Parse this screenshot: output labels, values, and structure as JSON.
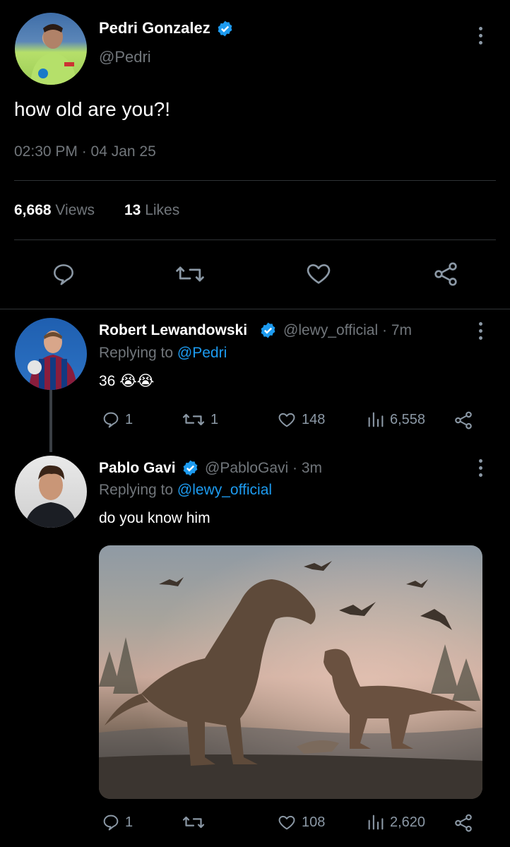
{
  "main_tweet": {
    "author_name": "Pedri Gonzalez",
    "handle": "@Pedri",
    "text": "how old are you?!",
    "timestamp": "02:30 PM · 04 Jan 25",
    "views_count": "6,668",
    "views_label": "Views",
    "likes_count": "13",
    "likes_label": "Likes"
  },
  "reply1": {
    "author_name": "Robert Lewandowski",
    "handle_time": "@lewy_official · 7m",
    "replying_prefix": "Replying to",
    "replying_to": "@Pedri",
    "text": "36 😭😭",
    "replies": "1",
    "retweets": "1",
    "likes": "148",
    "views": "6,558"
  },
  "reply2": {
    "author_name": "Pablo Gavi",
    "handle_time": "@PabloGavi · 3m",
    "replying_prefix": "Replying to",
    "replying_to": "@lewy_official",
    "text": "do you know him",
    "replies": "1",
    "likes": "108",
    "views": "2,620"
  },
  "colors": {
    "background": "#000000",
    "text": "#e7e9ea",
    "muted": "#71767b",
    "accent": "#1d9bf0"
  }
}
